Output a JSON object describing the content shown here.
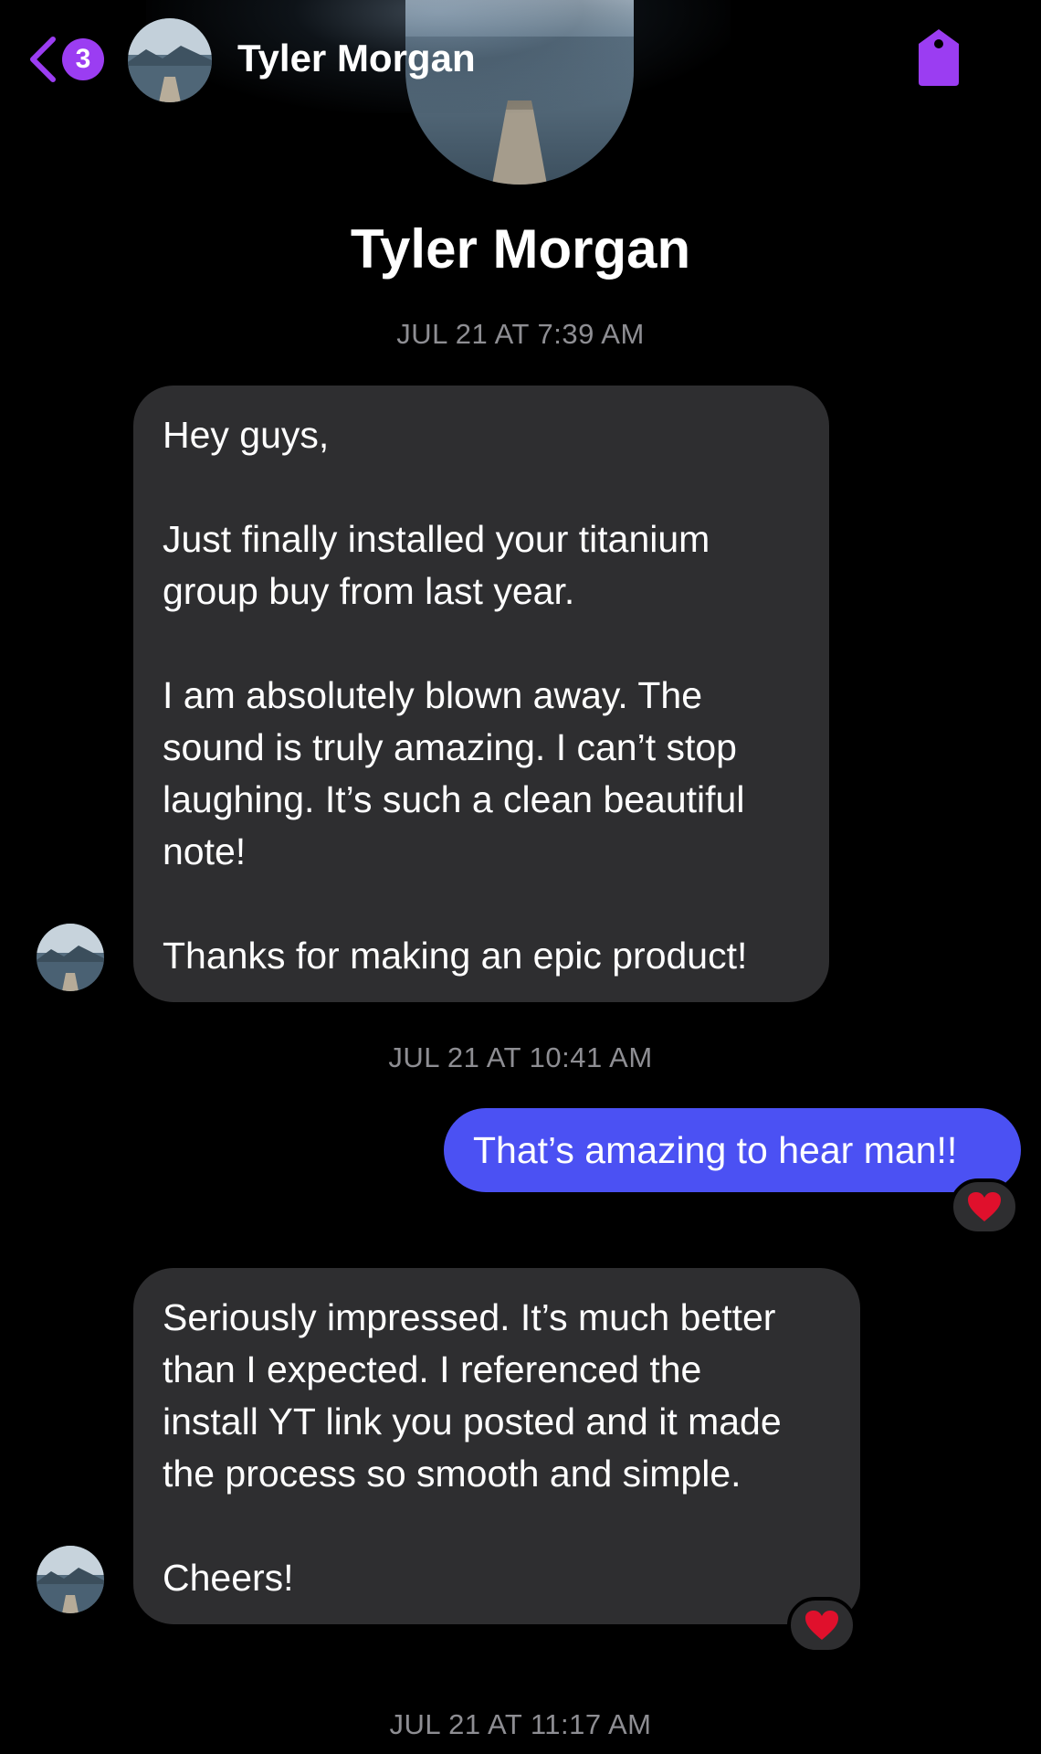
{
  "header": {
    "back_badge": "3",
    "contact_name": "Tyler Morgan",
    "back_icon": "chevron-left-icon",
    "tag_icon": "tag-icon",
    "accent_color": "#9b3df2"
  },
  "profile": {
    "name": "Tyler Morgan"
  },
  "messages": [
    {
      "timestamp": "JUL 21 AT 7:39 AM",
      "direction": "incoming",
      "paragraphs": [
        "Hey guys,",
        "Just finally installed your titanium\ngroup buy from last year.",
        "I am absolutely blown away. The\nsound is truly amazing. I can’t stop\nlaughing. It’s such a clean beautiful\nnote!",
        "Thanks for making an epic product!"
      ]
    },
    {
      "timestamp": "JUL 21 AT 10:41 AM",
      "direction": "outgoing",
      "text": "That’s amazing to hear man!!",
      "reaction": "heart"
    },
    {
      "direction": "incoming",
      "paragraphs": [
        "Seriously impressed. It’s much better\nthan I expected. I referenced the\ninstall YT link you posted and it made\nthe process so smooth and simple.",
        "Cheers!"
      ],
      "reaction": "heart"
    },
    {
      "timestamp": "JUL 21 AT 11:17 AM"
    }
  ],
  "colors": {
    "incoming_bubble": "#2e2e30",
    "outgoing_bubble": "#4b51f3",
    "timestamp": "#8e8e93",
    "heart": "#e0102c"
  }
}
